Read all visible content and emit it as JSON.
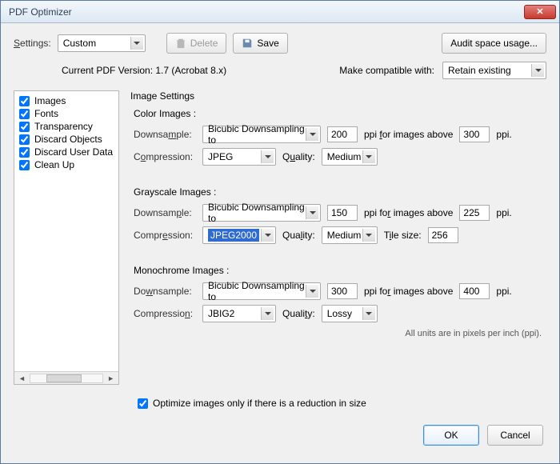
{
  "window": {
    "title": "PDF Optimizer"
  },
  "top": {
    "settingsLabel": "Settings:",
    "settingsValue": "Custom",
    "delete": "Delete",
    "save": "Save",
    "audit": "Audit space usage..."
  },
  "info": {
    "version": "Current PDF Version: 1.7 (Acrobat 8.x)",
    "compatLabel": "Make compatible with:",
    "compatValue": "Retain existing"
  },
  "sidebar": {
    "items": [
      {
        "label": "Images",
        "checked": true
      },
      {
        "label": "Fonts",
        "checked": true
      },
      {
        "label": "Transparency",
        "checked": true
      },
      {
        "label": "Discard Objects",
        "checked": true
      },
      {
        "label": "Discard User Data",
        "checked": true
      },
      {
        "label": "Clean Up",
        "checked": true
      }
    ]
  },
  "panel": {
    "title": "Image Settings",
    "section_color": "Color Images :",
    "section_gray": "Grayscale Images :",
    "section_mono": "Monochrome Images :",
    "downsampleLabel": "Downsample:",
    "compressionLabel": "Compression:",
    "qualityLabel": "Quality:",
    "tileLabel": "Tile size:",
    "forAbove": "ppi for images above",
    "ppi": "ppi.",
    "downsampleMethod": "Bicubic Downsampling to",
    "color": {
      "target": "200",
      "above": "300",
      "compression": "JPEG",
      "quality": "Medium"
    },
    "gray": {
      "target": "150",
      "above": "225",
      "compression": "JPEG2000",
      "quality": "Medium",
      "tile": "256"
    },
    "mono": {
      "target": "300",
      "above": "400",
      "compression": "JBIG2",
      "quality": "Lossy"
    },
    "unitsNote": "All units are in pixels per inch (ppi)."
  },
  "bottom": {
    "optimizeOnlyIfSmaller": "Optimize images only if there is a reduction in size",
    "ok": "OK",
    "cancel": "Cancel"
  }
}
